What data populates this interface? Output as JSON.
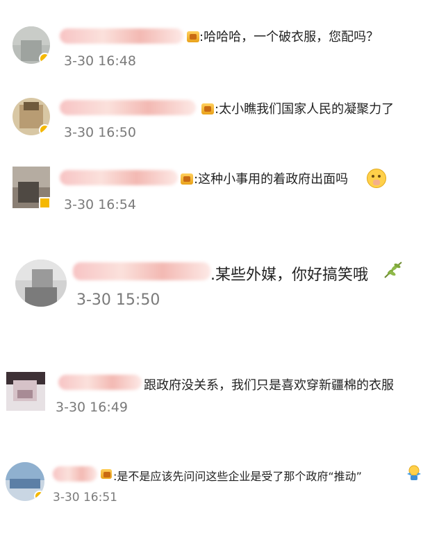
{
  "comments": [
    {
      "text": ":哈哈哈，一个破衣服，您配吗？",
      "time": "3-30 16:48"
    },
    {
      "text": ":太小瞧我们国家人民的凝聚力了",
      "time": "3-30 16:50"
    },
    {
      "text": ":这种小事用的着政府出面吗",
      "time": "3-30 16:54",
      "emoji": "shushing-face-emoji"
    },
    {
      "text": ".某些外媒，你好搞笑哦",
      "time": "3-30 15:50",
      "emoji": "olive-branch-emoji"
    },
    {
      "text": "跟政府没关系，我们只是喜欢穿新疆棉的衣服",
      "time": "3-30 16:49"
    },
    {
      "text": ":是不是应该先问问这些企业是受了那个政府“推动”",
      "time": "3-30 16:51",
      "emoji": "shrug-emoji"
    }
  ]
}
